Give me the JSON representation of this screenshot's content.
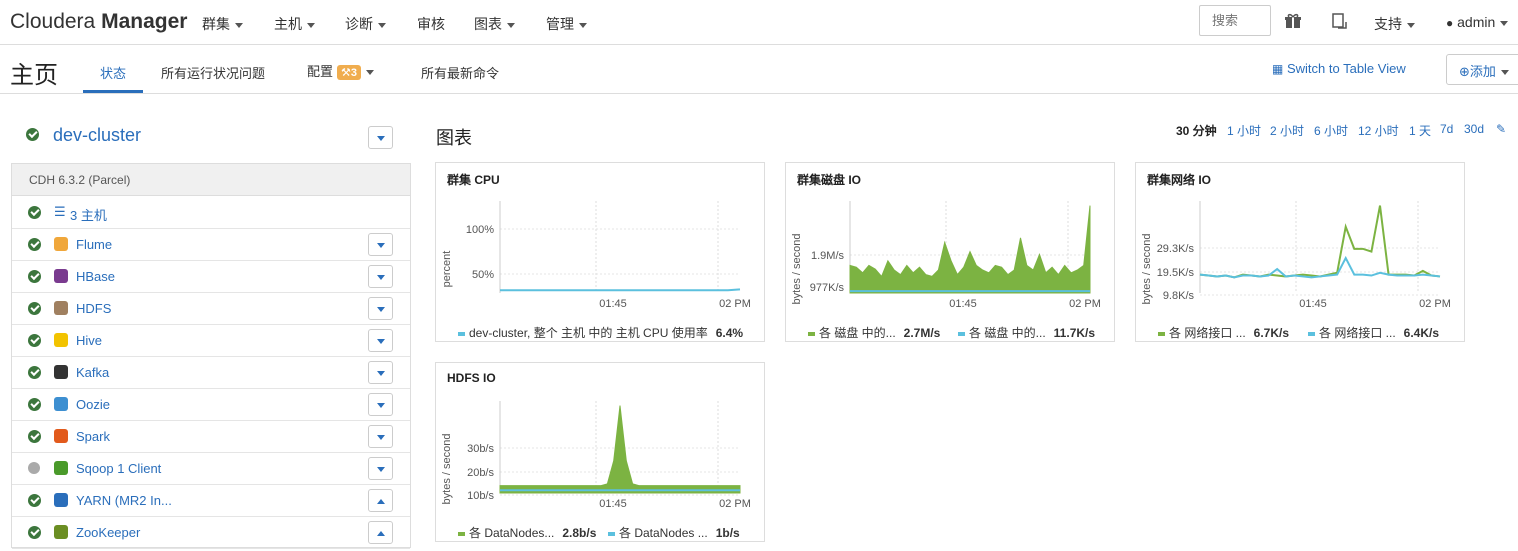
{
  "app": {
    "brand_light": "Cloudera",
    "brand_bold": "Manager"
  },
  "topnav": {
    "items": [
      "群集",
      "主机",
      "诊断",
      "审核",
      "图表",
      "管理"
    ],
    "search_placeholder": "搜索",
    "support": "支持",
    "user": "admin"
  },
  "subnav": {
    "title": "主页",
    "tabs": [
      "状态",
      "所有运行状况问题",
      "配置",
      "所有最新命令"
    ],
    "config_badge": "3",
    "switch_view": "Switch to Table View",
    "add_label": "添加"
  },
  "cluster": {
    "name": "dev-cluster",
    "version": "CDH 6.3.2 (Parcel)",
    "hosts": "3 主机",
    "services": [
      {
        "name": "Flume",
        "status": "ok",
        "icon_color": "#f0a73b"
      },
      {
        "name": "HBase",
        "status": "ok",
        "icon_color": "#7a3b8f"
      },
      {
        "name": "HDFS",
        "status": "ok",
        "icon_color": "#a08060"
      },
      {
        "name": "Hive",
        "status": "ok",
        "icon_color": "#f2c300"
      },
      {
        "name": "Kafka",
        "status": "ok",
        "icon_color": "#333333"
      },
      {
        "name": "Oozie",
        "status": "ok",
        "icon_color": "#3d8fd1"
      },
      {
        "name": "Spark",
        "status": "ok",
        "icon_color": "#e25a1c"
      },
      {
        "name": "Sqoop 1 Client",
        "status": "none",
        "icon_color": "#4a9a2a"
      },
      {
        "name": "YARN (MR2 In...",
        "status": "ok",
        "icon_color": "#2a6ebb"
      },
      {
        "name": "ZooKeeper",
        "status": "ok",
        "icon_color": "#6b8e23"
      }
    ]
  },
  "charts": {
    "heading": "图表",
    "ranges": [
      "30 分钟",
      "1 小时",
      "2 小时",
      "6 小时",
      "12 小时",
      "1 天",
      "7d",
      "30d"
    ],
    "panels": [
      {
        "title": "群集 CPU",
        "ylabel": "percent",
        "ticks": [
          "100%",
          "50%"
        ],
        "xticks": [
          "01:45",
          "02 PM"
        ],
        "legend": [
          {
            "label": "dev-cluster, 整个 主机 中的 主机 CPU 使用率",
            "value": "6.4%",
            "color": "#5bc0de"
          }
        ]
      },
      {
        "title": "群集磁盘 IO",
        "ylabel": "bytes / second",
        "ticks": [
          "1.9M/s",
          "977K/s"
        ],
        "xticks": [
          "01:45",
          "02 PM"
        ],
        "legend": [
          {
            "label": "各 磁盘 中的...",
            "value": "2.7M/s",
            "color": "#7cb342"
          },
          {
            "label": "各 磁盘 中的...",
            "value": "11.7K/s",
            "color": "#5bc0de"
          }
        ]
      },
      {
        "title": "群集网络 IO",
        "ylabel": "bytes / second",
        "ticks": [
          "29.3K/s",
          "19.5K/s",
          "9.8K/s"
        ],
        "xticks": [
          "01:45",
          "02 PM"
        ],
        "legend": [
          {
            "label": "各 网络接口 ...",
            "value": "6.7K/s",
            "color": "#7cb342"
          },
          {
            "label": "各 网络接口 ...",
            "value": "6.4K/s",
            "color": "#5bc0de"
          }
        ]
      },
      {
        "title": "HDFS IO",
        "ylabel": "bytes / second",
        "ticks": [
          "30b/s",
          "20b/s",
          "10b/s"
        ],
        "xticks": [
          "01:45",
          "02 PM"
        ],
        "legend": [
          {
            "label": "各 DataNodes...",
            "value": "2.8b/s",
            "color": "#7cb342"
          },
          {
            "label": "各 DataNodes ...",
            "value": "1b/s",
            "color": "#5bc0de"
          }
        ]
      }
    ]
  }
}
